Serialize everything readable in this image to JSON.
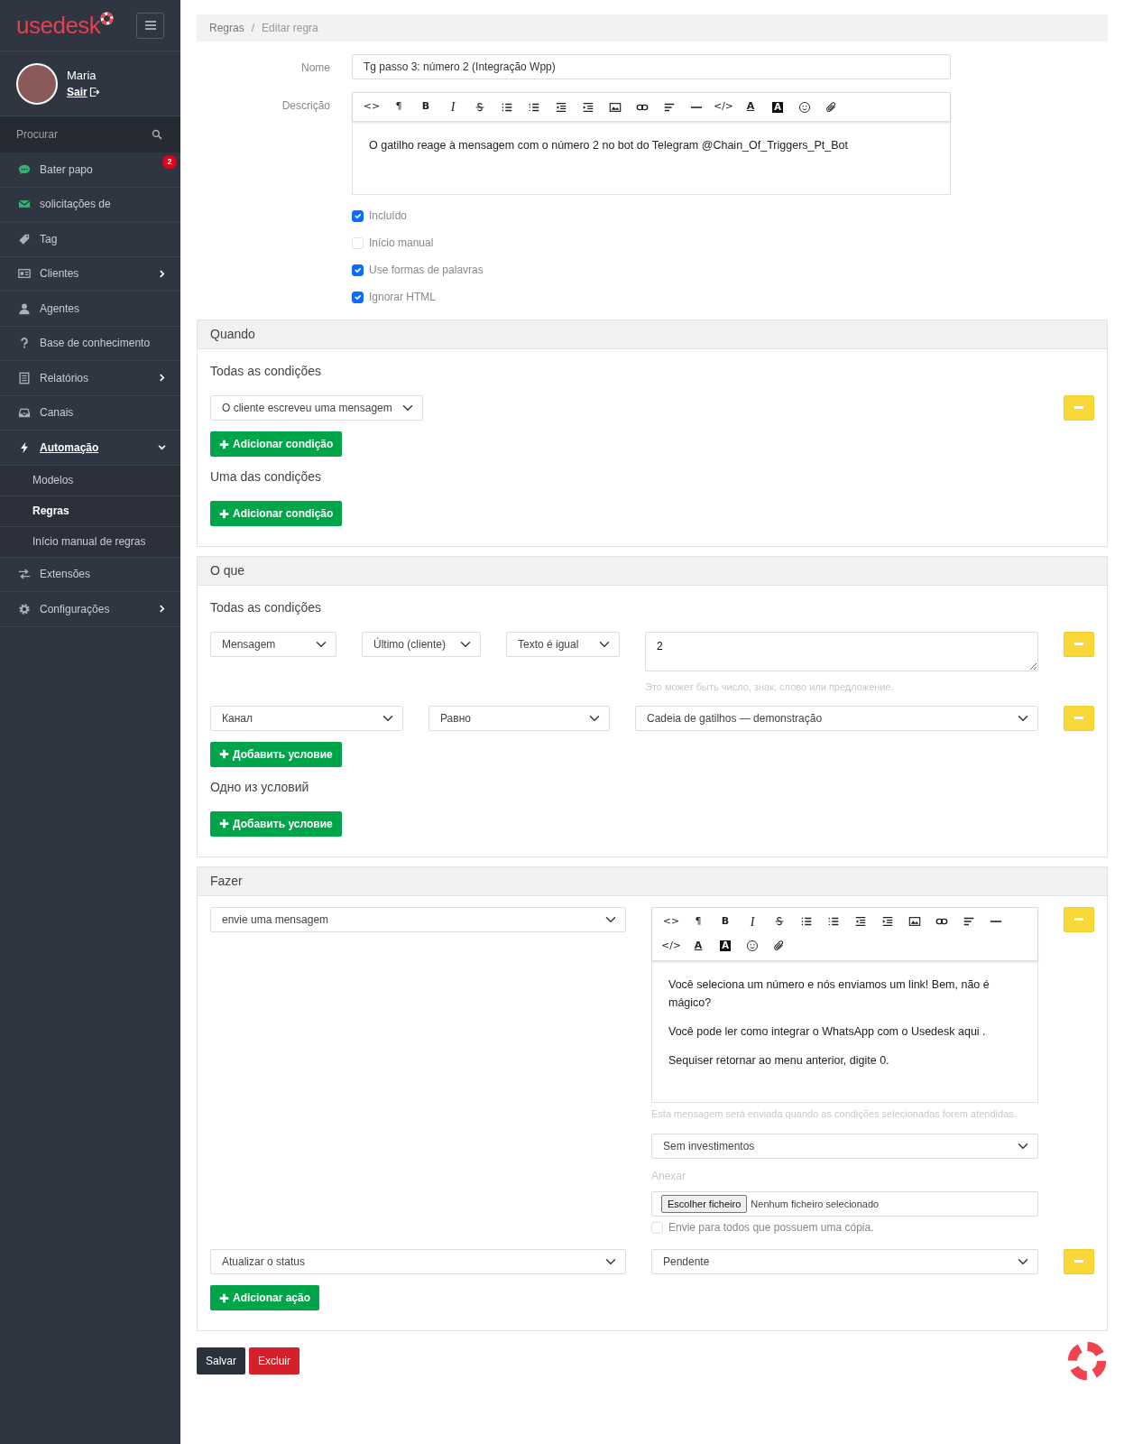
{
  "sidebar": {
    "logo": "usedesk",
    "user": {
      "name": "Maria",
      "logout": "Sair"
    },
    "search": {
      "placeholder": "Procurar"
    },
    "items": [
      {
        "label": "Bater papo",
        "badge": "2",
        "selected": false
      },
      {
        "label": "solicitações de",
        "selected": false
      },
      {
        "label": "Tag",
        "selected": false
      },
      {
        "label": "Clientes",
        "expanded": false,
        "selected": false
      },
      {
        "label": "Agentes",
        "selected": false
      },
      {
        "label": "Base de conhecimento",
        "selected": false
      },
      {
        "label": "Relatórios",
        "expanded": false,
        "selected": false
      },
      {
        "label": "Canais",
        "selected": false
      },
      {
        "label": "Automação",
        "expanded": true,
        "selected": true,
        "children": [
          {
            "label": "Modelos",
            "selected": false
          },
          {
            "label": "Regras",
            "selected": true
          },
          {
            "label": "Início manual de regras",
            "selected": false
          }
        ]
      },
      {
        "label": "Extensões",
        "selected": false
      },
      {
        "label": "Configurações",
        "expanded": false,
        "selected": false
      }
    ]
  },
  "breadcrumb": {
    "separator": "/",
    "items": [
      "Regras",
      "Editar regra"
    ]
  },
  "form": {
    "name": {
      "label": "Nome",
      "value": "Tg passo 3: número 2 (Integração Wpp)"
    },
    "description": {
      "label": "Descrição",
      "toolbar": [
        {
          "kind": "code",
          "text": "<>"
        },
        {
          "kind": "paragraph",
          "text": "¶"
        },
        {
          "kind": "bold",
          "text": "B"
        },
        {
          "kind": "italic",
          "text": "I"
        },
        {
          "kind": "strike"
        },
        {
          "kind": "ul"
        },
        {
          "kind": "ol"
        },
        {
          "kind": "outdent"
        },
        {
          "kind": "indent"
        },
        {
          "kind": "image"
        },
        {
          "kind": "link"
        },
        {
          "kind": "align"
        },
        {
          "kind": "hr"
        },
        {
          "kind": "codeview",
          "text": "</>"
        },
        {
          "kind": "color",
          "text": "A"
        },
        {
          "kind": "highlight",
          "text": "A"
        },
        {
          "kind": "emoji"
        },
        {
          "kind": "attach"
        }
      ],
      "text": "O gatilho reage à mensagem com o número 2 no bot do Telegram @Chain_Of_Triggers_Pt_Bot"
    },
    "options": [
      {
        "label": "Incluído",
        "checked": true
      },
      {
        "label": "Início manual",
        "checked": false
      },
      {
        "label": "Use formas de palavras",
        "checked": true
      },
      {
        "label": "Ignorar HTML",
        "checked": true
      }
    ]
  },
  "sections": [
    {
      "title": "Quando",
      "groups": [
        {
          "title": "Todas as condições",
          "rows": [
            {
              "kind": "single",
              "fields": [
                {
                  "kind": "select",
                  "value": "O cliente escreveu uma mensagem"
                }
              ]
            }
          ],
          "add": "Adicionar condição"
        },
        {
          "title": "Uma das condições",
          "add": "Adicionar condição"
        }
      ]
    },
    {
      "title": "O que",
      "groups": [
        {
          "title": "Todas as condições",
          "rows": [
            {
              "kind": "text",
              "fields": [
                {
                  "kind": "select",
                  "value": "Mensagem"
                },
                {
                  "kind": "select",
                  "value": "Último (cliente)"
                },
                {
                  "kind": "select",
                  "value": "Texto é igual"
                },
                {
                  "kind": "textarea",
                  "value": "2",
                  "help": "Это может быть число, знак, слово или предложение."
                }
              ]
            },
            {
              "kind": "select",
              "fields": [
                {
                  "kind": "select",
                  "value": "Канал"
                },
                {
                  "kind": "select",
                  "value": "Равно"
                },
                {
                  "kind": "select",
                  "value": "Cadeia de gatilhos — demonstração"
                }
              ]
            }
          ],
          "add": "Добавить условие"
        },
        {
          "title": "Одно из условий",
          "add": "Добавить условие"
        }
      ]
    },
    {
      "title": "Fazer",
      "groups": [
        {
          "rows": [
            {
              "kind": "message",
              "fields": [
                {
                  "kind": "select",
                  "value": "envie uma mensagem"
                }
              ],
              "editor": {
                "toolbar": [
                  {
                    "kind": "code",
                    "text": "<>"
                  },
                  {
                    "kind": "paragraph",
                    "text": "¶"
                  },
                  {
                    "kind": "bold",
                    "text": "B"
                  },
                  {
                    "kind": "italic",
                    "text": "I"
                  },
                  {
                    "kind": "strike"
                  },
                  {
                    "kind": "ul"
                  },
                  {
                    "kind": "ol"
                  },
                  {
                    "kind": "outdent"
                  },
                  {
                    "kind": "indent"
                  },
                  {
                    "kind": "image"
                  },
                  {
                    "kind": "link"
                  },
                  {
                    "kind": "align"
                  },
                  {
                    "kind": "hr"
                  },
                  {
                    "kind": "codeview",
                    "text": "</>"
                  },
                  {
                    "kind": "color",
                    "text": "A"
                  },
                  {
                    "kind": "highlight",
                    "text": "A"
                  },
                  {
                    "kind": "emoji"
                  },
                  {
                    "kind": "attach"
                  }
                ],
                "paragraphs": [
                  {
                    "text": "Você seleciona um número e nós enviamos um link! Bem, não é mágico?"
                  },
                  {
                    "text": "Você pode ler como integrar o WhatsApp com o Usedesk ",
                    "link": "aqui",
                    "after": " ."
                  },
                  {
                    "text": "Sequiser retornar ao menu anterior, digite 0."
                  }
                ]
              },
              "help": "Esta mensagem será enviada quando as condições selecionadas forem atendidas.",
              "template": "Sem investimentos",
              "attach_label": "Anexar",
              "file": {
                "button": "Escolher ficheiro",
                "status": "Nenhum ficheiro selecionado"
              },
              "copy": {
                "label": "Envie para todos que possuem uma cópia.",
                "checked": false
              }
            },
            {
              "kind": "status",
              "fields": [
                {
                  "kind": "select",
                  "value": "Atualizar o status"
                },
                {
                  "kind": "select",
                  "value": "Pendente"
                }
              ]
            }
          ],
          "add": "Adicionar ação"
        }
      ]
    }
  ],
  "buttons": [
    {
      "label": "Salvar"
    },
    {
      "label": "Excluir"
    }
  ]
}
